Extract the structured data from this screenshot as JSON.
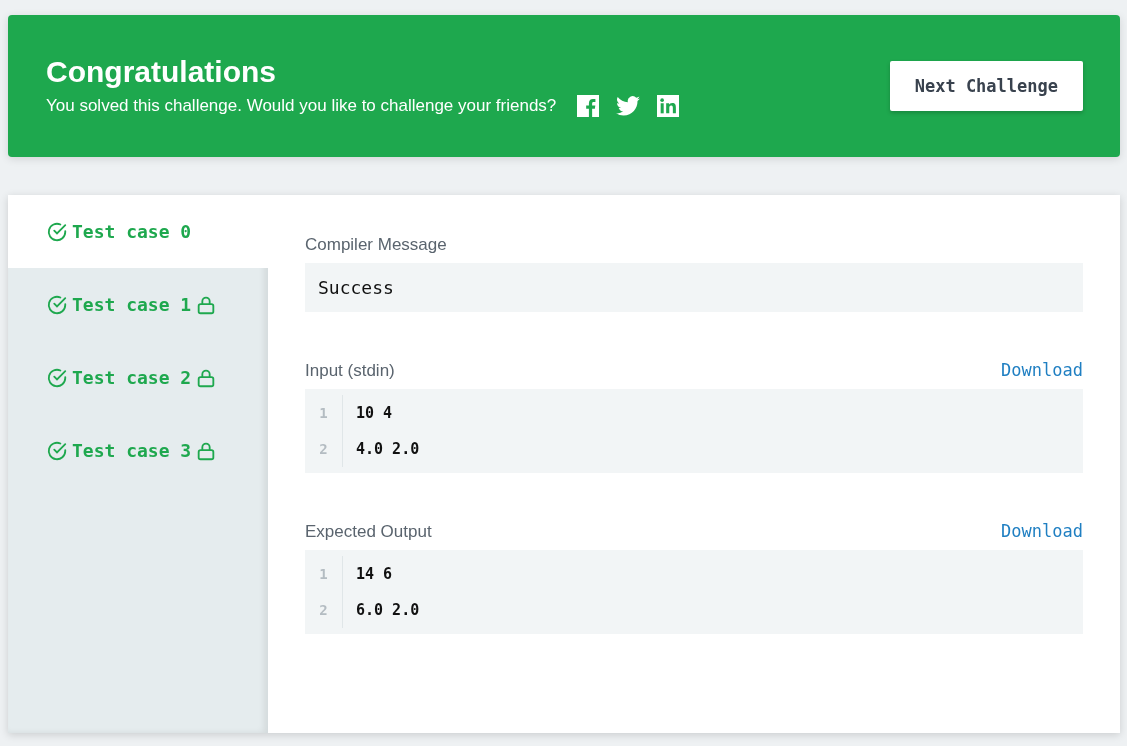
{
  "banner": {
    "title": "Congratulations",
    "message": "You solved this challenge. Would you like to challenge your friends?",
    "share": [
      {
        "kind": "facebook"
      },
      {
        "kind": "twitter"
      },
      {
        "kind": "linkedin"
      }
    ],
    "button": "Next Challenge"
  },
  "test_cases": [
    {
      "label": "Test case 0",
      "selected": true,
      "locked": false
    },
    {
      "label": "Test case 1",
      "selected": false,
      "locked": true
    },
    {
      "label": "Test case 2",
      "selected": false,
      "locked": true
    },
    {
      "label": "Test case 3",
      "selected": false,
      "locked": true
    }
  ],
  "sections": [
    {
      "kind": "message",
      "label": "Compiler Message",
      "text": "Success"
    },
    {
      "kind": "code",
      "label": "Input (stdin)",
      "link": "Download",
      "lines": [
        {
          "number": "1",
          "text": "10 4"
        },
        {
          "number": "2",
          "text": "4.0 2.0"
        }
      ]
    },
    {
      "kind": "code",
      "label": "Expected Output",
      "link": "Download",
      "lines": [
        {
          "number": "1",
          "text": "14 6"
        },
        {
          "number": "2",
          "text": "6.0 2.0"
        }
      ]
    }
  ]
}
